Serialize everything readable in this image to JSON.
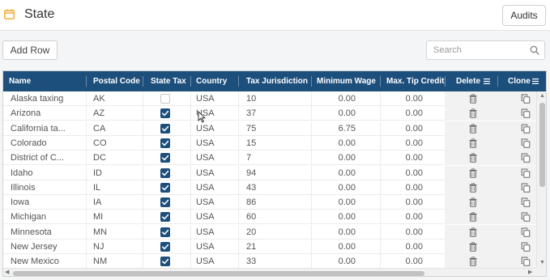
{
  "header": {
    "title": "State",
    "audits_label": "Audits",
    "calendar_icon": "calendar-icon",
    "accent_color": "#f5a623"
  },
  "toolbar": {
    "add_row_label": "Add Row",
    "search_placeholder": "Search",
    "search_value": ""
  },
  "grid": {
    "header_color": "#1d4f7c",
    "columns": [
      "Name",
      "Postal Code",
      "State Tax",
      "Country",
      "Tax Jurisdiction",
      "Minimum Wage",
      "Max. Tip Credit",
      "Delete",
      "Clone"
    ],
    "rows": [
      {
        "name": "Alaska taxing",
        "postal": "AK",
        "state_tax": false,
        "country": "USA",
        "jurisdiction": "10",
        "min_wage": "0.00",
        "tip_credit": "0.00"
      },
      {
        "name": "Arizona",
        "postal": "AZ",
        "state_tax": true,
        "country": "USA",
        "jurisdiction": "37",
        "min_wage": "0.00",
        "tip_credit": "0.00"
      },
      {
        "name": "California ta...",
        "postal": "CA",
        "state_tax": true,
        "country": "USA",
        "jurisdiction": "75",
        "min_wage": "6.75",
        "tip_credit": "0.00"
      },
      {
        "name": "Colorado",
        "postal": "CO",
        "state_tax": true,
        "country": "USA",
        "jurisdiction": "15",
        "min_wage": "0.00",
        "tip_credit": "0.00"
      },
      {
        "name": "District of C...",
        "postal": "DC",
        "state_tax": true,
        "country": "USA",
        "jurisdiction": "7",
        "min_wage": "0.00",
        "tip_credit": "0.00"
      },
      {
        "name": "Idaho",
        "postal": "ID",
        "state_tax": true,
        "country": "USA",
        "jurisdiction": "94",
        "min_wage": "0.00",
        "tip_credit": "0.00"
      },
      {
        "name": "Illinois",
        "postal": "IL",
        "state_tax": true,
        "country": "USA",
        "jurisdiction": "43",
        "min_wage": "0.00",
        "tip_credit": "0.00"
      },
      {
        "name": "Iowa",
        "postal": "IA",
        "state_tax": true,
        "country": "USA",
        "jurisdiction": "86",
        "min_wage": "0.00",
        "tip_credit": "0.00"
      },
      {
        "name": "Michigan",
        "postal": "MI",
        "state_tax": true,
        "country": "USA",
        "jurisdiction": "60",
        "min_wage": "0.00",
        "tip_credit": "0.00"
      },
      {
        "name": "Minnesota",
        "postal": "MN",
        "state_tax": true,
        "country": "USA",
        "jurisdiction": "20",
        "min_wage": "0.00",
        "tip_credit": "0.00"
      },
      {
        "name": "New Jersey",
        "postal": "NJ",
        "state_tax": true,
        "country": "USA",
        "jurisdiction": "21",
        "min_wage": "0.00",
        "tip_credit": "0.00"
      },
      {
        "name": "New Mexico",
        "postal": "NM",
        "state_tax": true,
        "country": "USA",
        "jurisdiction": "33",
        "min_wage": "0.00",
        "tip_credit": "0.00"
      }
    ]
  }
}
